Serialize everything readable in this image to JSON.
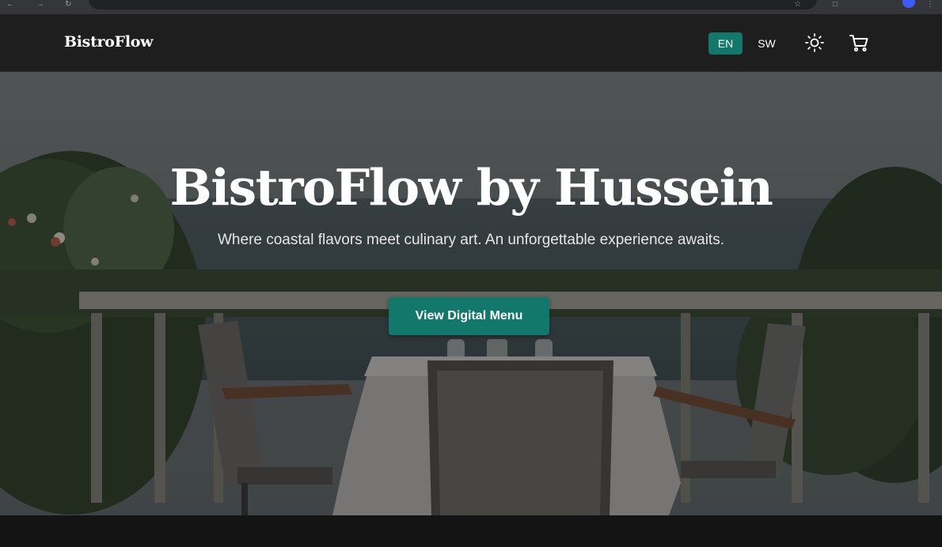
{
  "colors": {
    "accent": "#11786b",
    "navbar_bg": "#1e1e1e",
    "page_bg": "#141414",
    "text": "#ffffff"
  },
  "navbar": {
    "brand": "BistroFlow",
    "languages": [
      {
        "label": "EN",
        "active": true
      },
      {
        "label": "SW",
        "active": false
      }
    ],
    "theme_toggle_icon": "sun-icon",
    "cart_icon": "cart-icon"
  },
  "hero": {
    "title": "BistroFlow by Hussein",
    "subtitle": "Where coastal flavors meet culinary art. An unforgettable experience awaits.",
    "cta_label": "View Digital Menu",
    "background": "seaside-terrace-dining-photo"
  }
}
